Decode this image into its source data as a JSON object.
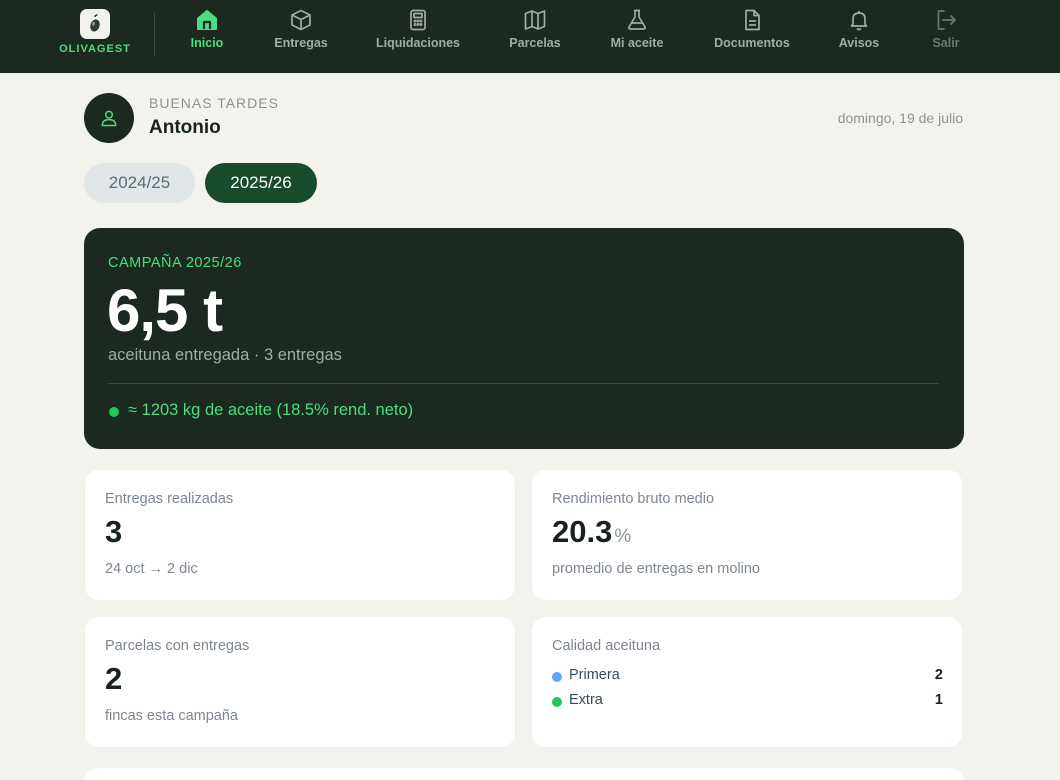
{
  "brand": {
    "name": "OLIVAGEST",
    "logo_icon": "olive-icon"
  },
  "nav": {
    "items": [
      {
        "label": "Inicio",
        "icon": "home-icon",
        "active": true
      },
      {
        "label": "Entregas",
        "icon": "box-icon"
      },
      {
        "label": "Liquidaciones",
        "icon": "calculator-icon"
      },
      {
        "label": "Parcelas",
        "icon": "map-icon"
      },
      {
        "label": "Mi aceite",
        "icon": "flask-icon"
      },
      {
        "label": "Documentos",
        "icon": "document-icon"
      },
      {
        "label": "Avisos",
        "icon": "bell-icon"
      },
      {
        "label": "Salir",
        "icon": "logout-icon"
      }
    ]
  },
  "greeting": {
    "salutation": "BUENAS TARDES",
    "name": "Antonio",
    "date": "domingo, 19 de julio"
  },
  "seasons": {
    "items": [
      "2024/25",
      "2025/26"
    ],
    "selected": "2025/26"
  },
  "hero": {
    "label": "CAMPAÑA 2025/26",
    "value": "6,5 t",
    "subtitle": "aceituna entregada · 3 entregas",
    "oil_estimate": "≈ 1203 kg de aceite (18.5% rend. neto)"
  },
  "stats": {
    "deliveries": {
      "label": "Entregas realizadas",
      "value": "3",
      "sub": "24 oct → 2 dic"
    },
    "yield": {
      "label": "Rendimiento bruto medio",
      "value": "20.3",
      "unit": "%",
      "sub": "promedio de entregas en molino"
    },
    "plots": {
      "label": "Parcelas con entregas",
      "value": "2",
      "sub": "fincas esta campaña"
    },
    "quality": {
      "label": "Calidad aceituna",
      "items": [
        {
          "name": "Primera",
          "count": "2",
          "color": "#60a5fa"
        },
        {
          "name": "Extra",
          "count": "1",
          "color": "#22c55e"
        }
      ]
    }
  },
  "colors": {
    "nav_bg": "#1b2920",
    "accent": "#4ade80",
    "selected_pill": "#184a2c",
    "page_bg": "#f3f3ee"
  }
}
